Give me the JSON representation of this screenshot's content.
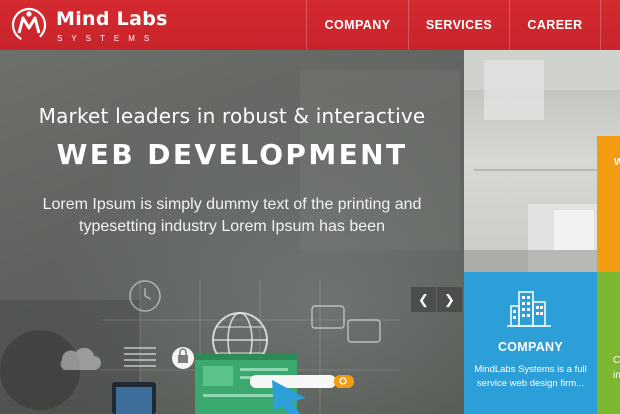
{
  "header": {
    "brand_name": "Mind Labs",
    "brand_sub": "SYSTEMS",
    "nav": [
      {
        "label": "COMPANY"
      },
      {
        "label": "SERVICES"
      },
      {
        "label": "CAREER"
      }
    ]
  },
  "hero": {
    "tagline": "Market leaders in robust & interactive",
    "title": "WEB DEVELOPMENT",
    "text": "Lorem Ipsum is simply dummy text of the printing and typesetting industry Lorem Ipsum has been"
  },
  "slider": {
    "prev_icon": "arrow-left-icon",
    "next_icon": "arrow-right-icon"
  },
  "tiles": {
    "company": {
      "icon": "building-icon",
      "title": "COMPANY",
      "description": "MindLabs Systems is a full service web design firm..."
    },
    "orange_partial": "W",
    "green_partial_1": "C",
    "green_partial_2": "in"
  },
  "colors": {
    "header_red": "#c8242b",
    "tile_blue": "#2d9fd8",
    "tile_orange": "#f39c12",
    "tile_green": "#7cb82f"
  }
}
